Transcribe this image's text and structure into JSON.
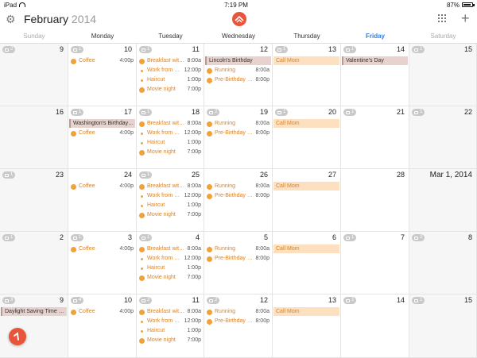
{
  "status": {
    "device": "iPad",
    "time": "7:19 PM",
    "battery": "87%"
  },
  "header": {
    "month": "February",
    "year": "2014"
  },
  "weekdays": [
    "Sunday",
    "Monday",
    "Tuesday",
    "Wednesday",
    "Thursday",
    "Friday",
    "Saturday"
  ],
  "weeks": [
    [
      {
        "day": "9",
        "wx": "2",
        "events": []
      },
      {
        "day": "10",
        "wx": "1",
        "events": [
          {
            "type": "icon",
            "name": "Coffee",
            "time": "4:00p"
          }
        ]
      },
      {
        "day": "11",
        "wx": "1",
        "events": [
          {
            "type": "icon",
            "name": "Breakfast with...",
            "time": "8:00a"
          },
          {
            "type": "dot",
            "name": "Work from ho...",
            "time": "12:00p"
          },
          {
            "type": "dot",
            "name": "Haircut",
            "time": "1:00p"
          },
          {
            "type": "icon",
            "name": "Movie night",
            "time": "7:00p"
          }
        ]
      },
      {
        "day": "12",
        "wx": "",
        "events": [
          {
            "type": "holiday",
            "name": "Lincoln's Birthday"
          },
          {
            "type": "icon",
            "name": "Running",
            "time": "8:00a"
          },
          {
            "type": "icon",
            "name": "Pre-Birthday Di...",
            "time": "8:00p"
          }
        ]
      },
      {
        "day": "13",
        "wx": "1",
        "events": [
          {
            "type": "call",
            "name": "Call Mom"
          }
        ]
      },
      {
        "day": "14",
        "wx": "1",
        "events": [
          {
            "type": "holiday",
            "name": "Valentine's Day"
          }
        ]
      },
      {
        "day": "15",
        "wx": "1",
        "events": []
      }
    ],
    [
      {
        "day": "16",
        "wx": "",
        "events": []
      },
      {
        "day": "17",
        "wx": "1",
        "events": [
          {
            "type": "holiday",
            "name": "Washington's Birthday (..."
          },
          {
            "type": "icon",
            "name": "Coffee",
            "time": "4:00p"
          }
        ]
      },
      {
        "day": "18",
        "wx": "1",
        "events": [
          {
            "type": "icon",
            "name": "Breakfast with...",
            "time": "8:00a"
          },
          {
            "type": "dot",
            "name": "Work from ho...",
            "time": "12:00p"
          },
          {
            "type": "dot",
            "name": "Haircut",
            "time": "1:00p"
          },
          {
            "type": "icon",
            "name": "Movie night",
            "time": "7:00p"
          }
        ]
      },
      {
        "day": "19",
        "wx": "2",
        "events": [
          {
            "type": "icon",
            "name": "Running",
            "time": "8:00a"
          },
          {
            "type": "icon",
            "name": "Pre-Birthday Di...",
            "time": "8:00p"
          }
        ]
      },
      {
        "day": "20",
        "wx": "1",
        "events": [
          {
            "type": "call",
            "name": "Call Mom"
          }
        ]
      },
      {
        "day": "21",
        "wx": "1",
        "events": []
      },
      {
        "day": "22",
        "wx": "1",
        "events": []
      }
    ],
    [
      {
        "day": "23",
        "wx": "1",
        "events": []
      },
      {
        "day": "24",
        "wx": "",
        "events": [
          {
            "type": "icon",
            "name": "Coffee",
            "time": "4:00p"
          }
        ]
      },
      {
        "day": "25",
        "wx": "1",
        "events": [
          {
            "type": "icon",
            "name": "Breakfast with...",
            "time": "8:00a"
          },
          {
            "type": "dot",
            "name": "Work from ho...",
            "time": "12:00p"
          },
          {
            "type": "dot",
            "name": "Haircut",
            "time": "1:00p"
          },
          {
            "type": "icon",
            "name": "Movie night",
            "time": "7:00p"
          }
        ]
      },
      {
        "day": "26",
        "wx": "",
        "events": [
          {
            "type": "icon",
            "name": "Running",
            "time": "8:00a"
          },
          {
            "type": "icon",
            "name": "Pre-Birthday Di...",
            "time": "8:00p"
          }
        ]
      },
      {
        "day": "27",
        "wx": "",
        "events": [
          {
            "type": "call",
            "name": "Call Mom"
          }
        ]
      },
      {
        "day": "28",
        "wx": "",
        "events": []
      },
      {
        "day": "Mar 1, 2014",
        "wx": "",
        "events": [],
        "big": true
      }
    ],
    [
      {
        "day": "2",
        "wx": "1",
        "events": []
      },
      {
        "day": "3",
        "wx": "1",
        "events": [
          {
            "type": "icon",
            "name": "Coffee",
            "time": "4:00p"
          }
        ]
      },
      {
        "day": "4",
        "wx": "1",
        "events": [
          {
            "type": "icon",
            "name": "Breakfast with...",
            "time": "8:00a"
          },
          {
            "type": "dot",
            "name": "Work from ho...",
            "time": "12:00p"
          },
          {
            "type": "dot",
            "name": "Haircut",
            "time": "1:00p"
          },
          {
            "type": "icon",
            "name": "Movie night",
            "time": "7:00p"
          }
        ]
      },
      {
        "day": "5",
        "wx": "",
        "events": [
          {
            "type": "icon",
            "name": "Running",
            "time": "8:00a"
          },
          {
            "type": "icon",
            "name": "Pre-Birthday Di...",
            "time": "8:00p"
          }
        ]
      },
      {
        "day": "6",
        "wx": "",
        "events": [
          {
            "type": "call",
            "name": "Call Mom"
          }
        ]
      },
      {
        "day": "7",
        "wx": "1",
        "events": []
      },
      {
        "day": "8",
        "wx": "2",
        "events": []
      }
    ],
    [
      {
        "day": "9",
        "wx": "3",
        "events": [
          {
            "type": "holiday",
            "name": "Daylight Saving Time B..."
          }
        ]
      },
      {
        "day": "10",
        "wx": "4",
        "events": [
          {
            "type": "icon",
            "name": "Coffee",
            "time": "4:00p"
          }
        ]
      },
      {
        "day": "11",
        "wx": "2",
        "events": [
          {
            "type": "icon",
            "name": "Breakfast with...",
            "time": "8:00a"
          },
          {
            "type": "dot",
            "name": "Work from ho...",
            "time": "12:00p"
          },
          {
            "type": "dot",
            "name": "Haircut",
            "time": "1:00p"
          },
          {
            "type": "icon",
            "name": "Movie night",
            "time": "7:00p"
          }
        ]
      },
      {
        "day": "12",
        "wx": "2",
        "events": [
          {
            "type": "icon",
            "name": "Running",
            "time": "8:00a"
          },
          {
            "type": "icon",
            "name": "Pre-Birthday Di...",
            "time": "8:00p"
          }
        ]
      },
      {
        "day": "13",
        "wx": "",
        "events": [
          {
            "type": "call",
            "name": "Call Mom"
          }
        ]
      },
      {
        "day": "14",
        "wx": "1",
        "events": []
      },
      {
        "day": "15",
        "wx": "1",
        "events": []
      }
    ]
  ],
  "colors": {
    "accent": "#e8553a",
    "event": "#d9842a",
    "today": "#2b7de9"
  }
}
